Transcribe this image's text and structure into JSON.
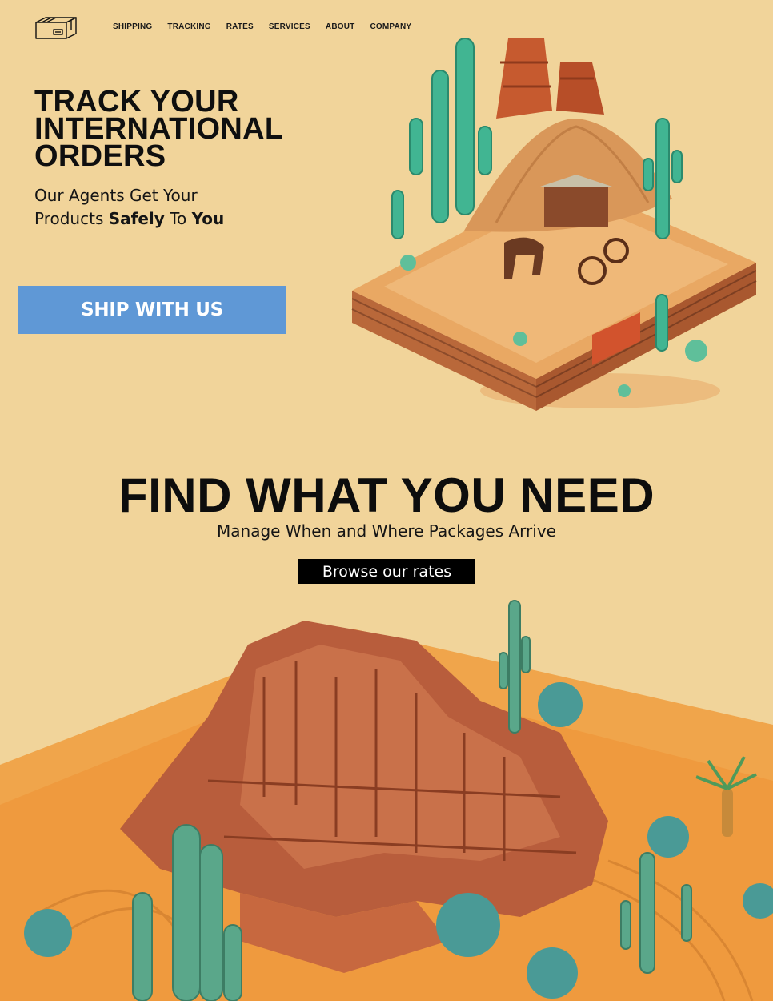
{
  "header": {
    "logo_icon": "package-box-icon",
    "nav": [
      "SHIPPING",
      "TRACKING",
      "RATES",
      "SERVICES",
      "ABOUT",
      "COMPANY"
    ]
  },
  "hero": {
    "title_lines": [
      "TRACK YOUR",
      "INTERNATIONAL",
      "ORDERS"
    ],
    "subtitle_line1": "Our Agents Get Your",
    "subtitle_line2_a": "Products ",
    "subtitle_line2_bold1": "Safely",
    "subtitle_line2_b": " To ",
    "subtitle_line2_bold2": "You",
    "cta_label": "SHIP WITH US",
    "cta_color": "#5f98d6"
  },
  "find": {
    "title": "FIND WHAT YOU NEED",
    "subtitle": "Manage When and Where Packages Arrive",
    "button_label": "Browse our rates"
  },
  "colors": {
    "background": "#f1d49a",
    "sand": "#f0a94e",
    "cactus": "#4fb89a",
    "rock": "#c0603a"
  }
}
